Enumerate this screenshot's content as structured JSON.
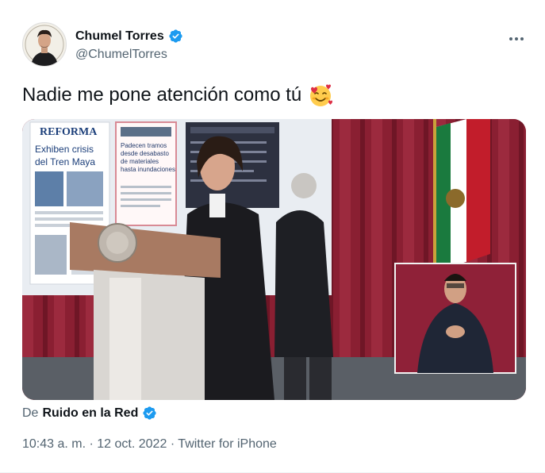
{
  "author": {
    "name": "Chumel Torres",
    "handle": "@ChumelTorres"
  },
  "tweet": {
    "text": "Nadie me pone atención como tú"
  },
  "media": {
    "newspaper_masthead": "REFORMA",
    "newspaper_headline_1": "Exhiben crisis",
    "newspaper_headline_2": "del Tren Maya",
    "clipping_lines": [
      "Padecen tramos",
      "desde desabasto",
      "de materiales",
      "hasta inundaciones"
    ]
  },
  "attribution": {
    "prefix": "De",
    "source": "Ruido en la Red"
  },
  "meta": {
    "time": "10:43 a. m.",
    "sep1": "·",
    "date": "12 oct. 2022",
    "sep2": "·",
    "client": "Twitter for iPhone"
  },
  "colors": {
    "verified": "#1d9bf0",
    "muted": "#536471",
    "text": "#0f1419"
  }
}
